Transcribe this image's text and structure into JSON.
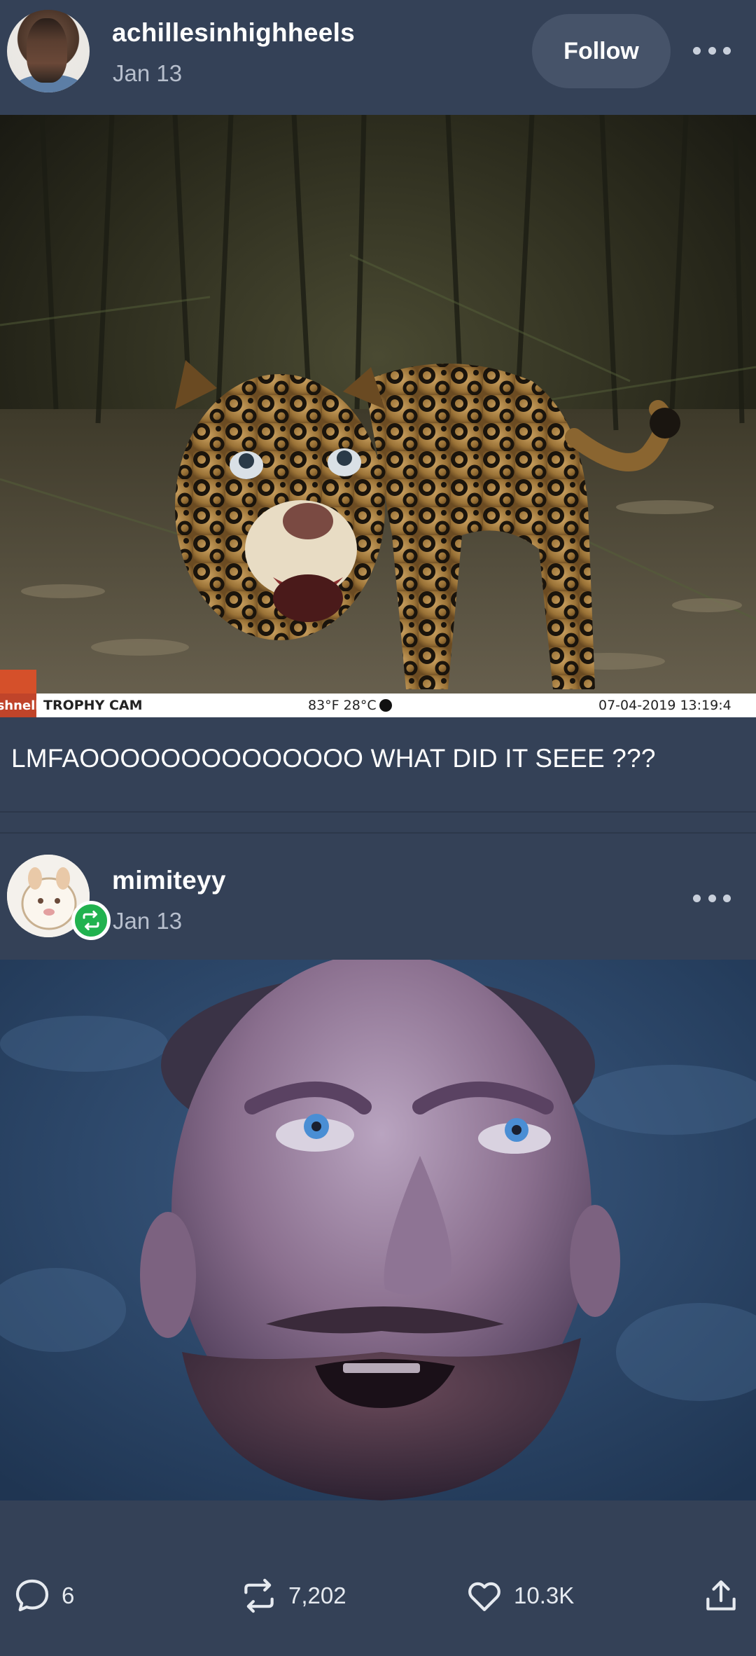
{
  "post1": {
    "username": "achillesinhighheels",
    "date": "Jan 13",
    "follow_label": "Follow",
    "caption": "LMFAOOOOOOOOOOOOOO WHAT DID IT SEEE ???",
    "image": {
      "subject": "jaguar-photo",
      "camera_brand": "TROPHY CAM",
      "camera_logo": "shnell",
      "temperature": "83°F 28°C",
      "timestamp": "07-04-2019  13:19:4"
    }
  },
  "post2": {
    "username": "mimiteyy",
    "date": "Jan 13",
    "image": {
      "subject": "man-looking-up-photo"
    }
  },
  "actions": {
    "comments_count": "6",
    "reblogs_count": "7,202",
    "likes_count": "10.3K"
  },
  "colors": {
    "background": "#344157",
    "follow_button": "#465369",
    "reblog_badge": "#21b24f",
    "secondary_text": "#b7bfcd"
  },
  "icons": [
    "more-icon",
    "reblog-icon",
    "comment-icon",
    "heart-icon",
    "share-icon"
  ]
}
